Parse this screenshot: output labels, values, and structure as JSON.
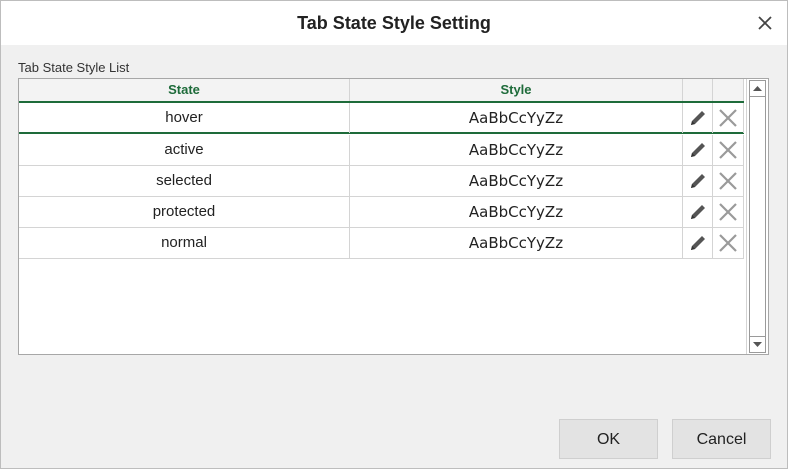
{
  "dialog": {
    "title": "Tab State Style Setting",
    "close_icon": "close-icon"
  },
  "list": {
    "label": "Tab State Style List",
    "columns": {
      "state": "State",
      "style": "Style"
    },
    "rows": [
      {
        "state": "hover",
        "style": "AaBbCcYyZz"
      },
      {
        "state": "active",
        "style": "AaBbCcYyZz"
      },
      {
        "state": "selected",
        "style": "AaBbCcYyZz"
      },
      {
        "state": "protected",
        "style": "AaBbCcYyZz"
      },
      {
        "state": "normal",
        "style": "AaBbCcYyZz"
      }
    ],
    "row_icons": {
      "edit": "pencil-icon",
      "delete": "delete-x-icon"
    },
    "accent_color": "#1e6b3a"
  },
  "buttons": {
    "ok": "OK",
    "cancel": "Cancel"
  }
}
